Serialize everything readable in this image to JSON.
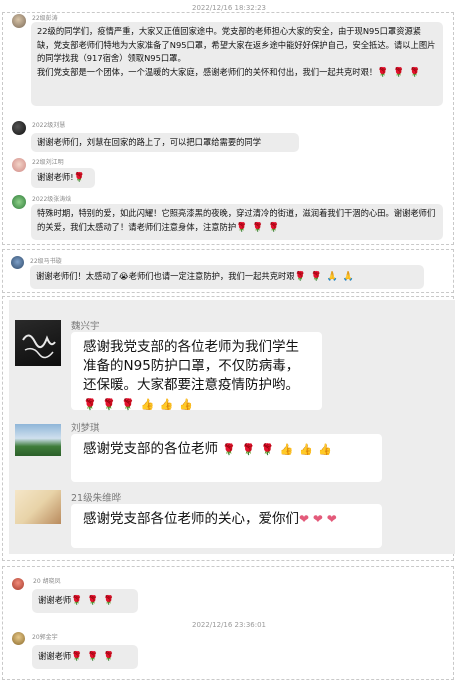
{
  "timestamps": {
    "first": "2022/12/16 18:32:23",
    "second": "2022/12/16 23:36:01"
  },
  "messages": [
    {
      "name": "22级彭涛",
      "text": "22级的同学们，疫情严重，大家又正值回家途中。党支部的老师担心大家的安全，由于现N95口罩资源紧缺，党支部老师们特地为大家准备了N95口罩，希望大家在返乡途中能好好保护自己，安全抵达。请以上图片的同学找我（917宿舍）领取N95口罩。",
      "text2": "我们党支部是一个团体，一个温暖的大家庭，感谢老师们的关怀和付出，我们一起共克时艰！",
      "emoji": "🌹 🌹 🌹"
    },
    {
      "name": "2022级刘慧",
      "text": "谢谢老师们，刘慧在回家的路上了，可以把口罩给需要的同学"
    },
    {
      "name": "22级刘江明",
      "text": "谢谢老师!",
      "emoji": "🌹"
    },
    {
      "name": "2022级张涛焓",
      "text": "特殊时期，特别的爱，如此闪耀！它照亮漆黑的夜晚，穿过清冷的街道，滋润着我们干涸的心田。谢谢老师们的关爱，我们太感动了！请老师们注意身体，注意防护",
      "emoji": "🌹 🌹 🌹"
    },
    {
      "name": "22级马书璇",
      "text": "谢谢老师们！太感动了😭老师们也请一定注意防护，我们一起共克时艰",
      "emoji": "🌹 🌹 🙏 🙏"
    },
    {
      "name": "20 胡晓凤",
      "text": "谢谢老师",
      "emoji": "🌹 🌹 🌹"
    },
    {
      "name": "20郭金宇",
      "text": "谢谢老师",
      "emoji": "🌹 🌹 🌹"
    }
  ],
  "inner_chat": [
    {
      "name": "魏兴宇",
      "text": "感谢我党支部的各位老师为我们学生准备的N95防护口罩，不仅防病毒，还保暖。大家都要注意疫情防护哟。",
      "emoji": "🌹 🌹 🌹 👍 👍 👍"
    },
    {
      "name": "刘梦琪",
      "text": "感谢党支部的各位老师",
      "emoji": "🌹 🌹 🌹 👍 👍 👍"
    },
    {
      "name": "21级朱维晔",
      "text": "感谢党支部各位老师的关心，爱你们",
      "emoji": "❤ ❤ ❤"
    }
  ],
  "colors": {
    "bubble": "#ececec",
    "inner_bg": "#ededed",
    "rose": "#c0392b",
    "thumb": "#e5b93b"
  }
}
